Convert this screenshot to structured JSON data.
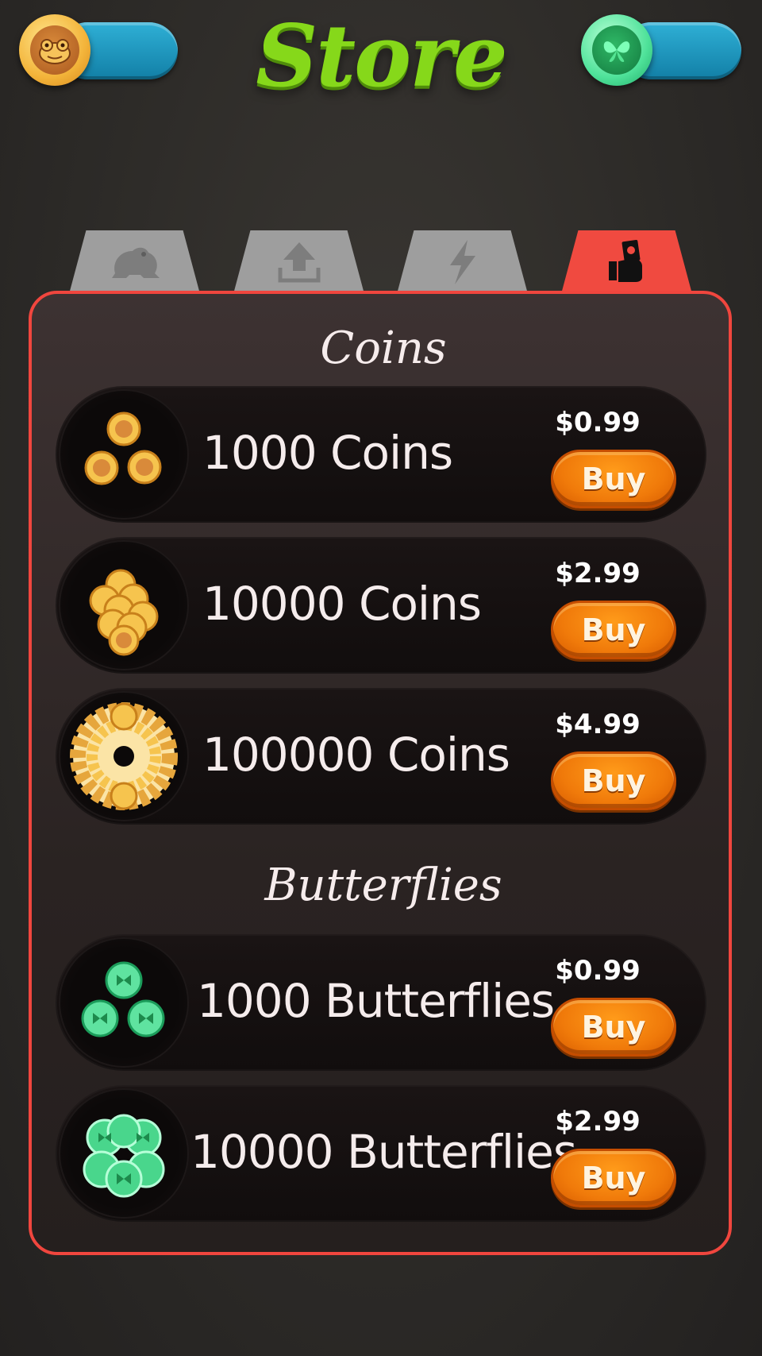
{
  "header": {
    "title": "Store",
    "coins_value": "",
    "butterflies_value": ""
  },
  "tabs": [
    {
      "icon": "frog-icon",
      "active": false
    },
    {
      "icon": "upload-icon",
      "active": false
    },
    {
      "icon": "lightning-icon",
      "active": false
    },
    {
      "icon": "hand-money-icon",
      "active": true
    }
  ],
  "sections": {
    "coins_title": "Coins",
    "butterflies_title": "Butterflies"
  },
  "coins": [
    {
      "label": "1000 Coins",
      "price": "$0.99",
      "buy": "Buy"
    },
    {
      "label": "10000 Coins",
      "price": "$2.99",
      "buy": "Buy"
    },
    {
      "label": "100000 Coins",
      "price": "$4.99",
      "buy": "Buy"
    }
  ],
  "butterflies": [
    {
      "label": "1000 Butterflies",
      "price": "$0.99",
      "buy": "Buy"
    },
    {
      "label": "10000 Butterflies",
      "price": "$2.99",
      "buy": "Buy"
    }
  ],
  "colors": {
    "title": "#86d81a",
    "panel_border": "#f0463e",
    "buy_button": "#f07a0a",
    "currency_pill": "#1f9cc4"
  }
}
